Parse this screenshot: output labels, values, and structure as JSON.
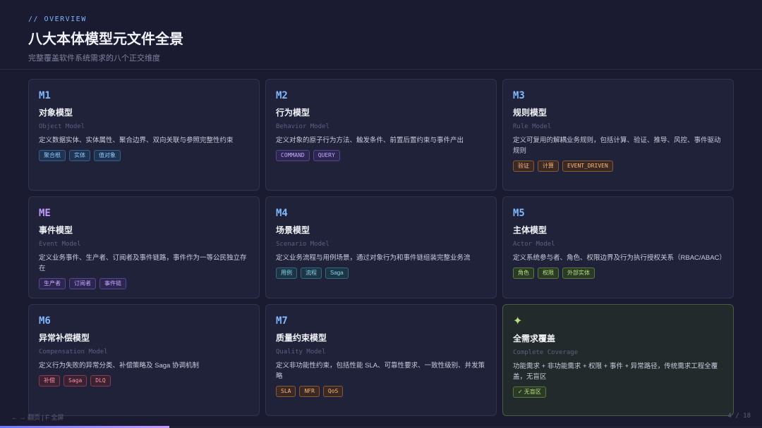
{
  "header": {
    "eyebrow": "// OVERVIEW",
    "title": "八大本体模型元文件全景",
    "subtitle": "完整覆盖软件系统需求的八个正交维度"
  },
  "cards": [
    {
      "code": "M1",
      "title": "对象模型",
      "subtitle": "Object Model",
      "desc": "定义数据实体、实体属性、聚合边界、双向关联与参照完整性约束",
      "tags": [
        "聚合根",
        "实体",
        "值对象"
      ]
    },
    {
      "code": "M2",
      "title": "行为模型",
      "subtitle": "Behavior Model",
      "desc": "定义对象的原子行为方法、触发条件、前置后置约束与事件产出",
      "tags": [
        "COMMAND",
        "QUERY"
      ]
    },
    {
      "code": "M3",
      "title": "规则模型",
      "subtitle": "Rule Model",
      "desc": "定义可复用的解耦业务规则，包括计算、验证、推导、风控、事件驱动规则",
      "tags": [
        "验证",
        "计算",
        "EVENT_DRIVEN"
      ]
    },
    {
      "code": "ME",
      "title": "事件模型",
      "subtitle": "Event Model",
      "desc": "定义业务事件、生产者、订阅者及事件链路，事件作为一等公民独立存在",
      "tags": [
        "生产者",
        "订阅者",
        "事件链"
      ]
    },
    {
      "code": "M4",
      "title": "场景模型",
      "subtitle": "Scenario Model",
      "desc": "定义业务流程与用例场景，通过对象行为和事件链组装完整业务流",
      "tags": [
        "用例",
        "流程",
        "Saga"
      ]
    },
    {
      "code": "M5",
      "title": "主体模型",
      "subtitle": "Actor Model",
      "desc": "定义系统参与者、角色、权限边界及行为执行授权关系（RBAC/ABAC）",
      "tags": [
        "角色",
        "权限",
        "外部实体"
      ]
    },
    {
      "code": "M6",
      "title": "异常补偿模型",
      "subtitle": "Compensation Model",
      "desc": "定义行为失败的异常分类、补偿策略及 Saga 协调机制",
      "tags": [
        "补偿",
        "Saga",
        "DLQ"
      ]
    },
    {
      "code": "M7",
      "title": "质量约束模型",
      "subtitle": "Quality Model",
      "desc": "定义非功能性约束，包括性能 SLA、可靠性要求、一致性级别、并发策略",
      "tags": [
        "SLA",
        "NFR",
        "QoS"
      ]
    },
    {
      "code": "✦",
      "title": "全需求覆盖",
      "subtitle": "Complete Coverage",
      "desc": "功能需求 + 非功能需求 + 权限 + 事件 + 异常路径，传统需求工程全覆盖，无盲区",
      "tags": [
        "✓ 无盲区"
      ]
    }
  ],
  "footer": {
    "nav_hint": "← → 翻页 | F 全屏",
    "page_indicator": "4 / 18",
    "progress": 0.222
  },
  "colors": {
    "background": "#1a1b30",
    "card": "#20223a",
    "accent_blue": "#7fb8ff",
    "accent_purple": "#c49bff",
    "accent_green": "#b6e07e"
  }
}
